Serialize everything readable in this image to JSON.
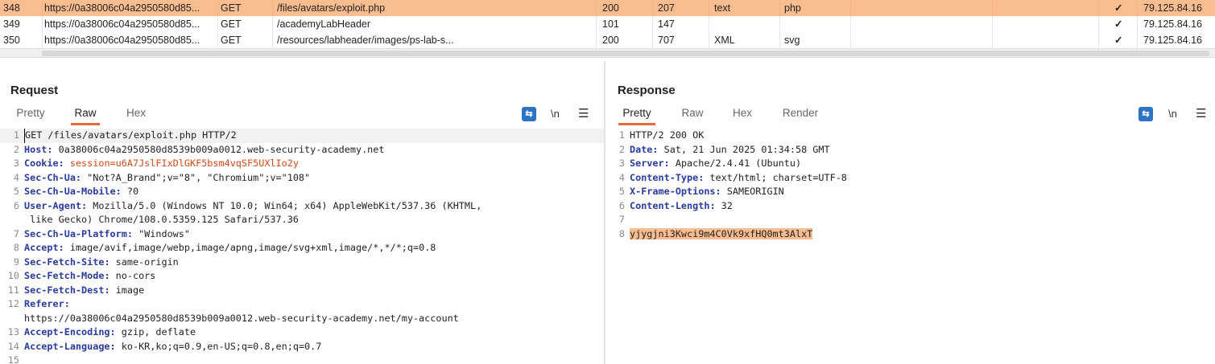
{
  "history": {
    "rows": [
      {
        "num": "348",
        "host": "https://0a38006c04a2950580d85...",
        "method": "GET",
        "url": "/files/avatars/exploit.php",
        "status": "200",
        "length": "207",
        "mime": "text",
        "ext": "php",
        "tls": "✓",
        "ip": "79.125.84.16",
        "selected": true
      },
      {
        "num": "349",
        "host": "https://0a38006c04a2950580d85...",
        "method": "GET",
        "url": "/academyLabHeader",
        "status": "101",
        "length": "147",
        "mime": "",
        "ext": "",
        "tls": "✓",
        "ip": "79.125.84.16",
        "selected": false
      },
      {
        "num": "350",
        "host": "https://0a38006c04a2950580d85...",
        "method": "GET",
        "url": "/resources/labheader/images/ps-lab-s...",
        "status": "200",
        "length": "707",
        "mime": "XML",
        "ext": "svg",
        "tls": "✓",
        "ip": "79.125.84.16",
        "selected": false
      }
    ]
  },
  "request": {
    "title": "Request",
    "tabs": [
      "Pretty",
      "Raw",
      "Hex"
    ],
    "active_tab": "Raw",
    "tools": {
      "wrap_icon": "wrap-lines-icon",
      "newline_label": "\\n",
      "menu_icon": "hamburger-menu-icon"
    },
    "lines": [
      {
        "n": "1",
        "name": "",
        "sep": "",
        "value": "GET /files/avatars/exploit.php HTTP/2"
      },
      {
        "n": "2",
        "name": "Host",
        "sep": ": ",
        "value": "0a38006c04a2950580d8539b009a0012.web-security-academy.net"
      },
      {
        "n": "3",
        "name": "Cookie",
        "sep": ": ",
        "value": "session=u6A7JslFIxDlGKF5bsm4vqSF5UXlIo2y",
        "cookie": true
      },
      {
        "n": "4",
        "name": "Sec-Ch-Ua",
        "sep": ": ",
        "value": "\"Not?A_Brand\";v=\"8\", \"Chromium\";v=\"108\""
      },
      {
        "n": "5",
        "name": "Sec-Ch-Ua-Mobile",
        "sep": ": ",
        "value": "?0"
      },
      {
        "n": "6",
        "name": "User-Agent",
        "sep": ": ",
        "value": "Mozilla/5.0 (Windows NT 10.0; Win64; x64) AppleWebKit/537.36 (KHTML,"
      },
      {
        "n": "",
        "name": "",
        "sep": "",
        "value": " like Gecko) Chrome/108.0.5359.125 Safari/537.36"
      },
      {
        "n": "7",
        "name": "Sec-Ch-Ua-Platform",
        "sep": ": ",
        "value": "\"Windows\""
      },
      {
        "n": "8",
        "name": "Accept",
        "sep": ": ",
        "value": "image/avif,image/webp,image/apng,image/svg+xml,image/*,*/*;q=0.8"
      },
      {
        "n": "9",
        "name": "Sec-Fetch-Site",
        "sep": ": ",
        "value": "same-origin"
      },
      {
        "n": "10",
        "name": "Sec-Fetch-Mode",
        "sep": ": ",
        "value": "no-cors"
      },
      {
        "n": "11",
        "name": "Sec-Fetch-Dest",
        "sep": ": ",
        "value": "image"
      },
      {
        "n": "12",
        "name": "Referer",
        "sep": ":",
        "value": ""
      },
      {
        "n": "",
        "name": "",
        "sep": "",
        "value": "https://0a38006c04a2950580d8539b009a0012.web-security-academy.net/my-account"
      },
      {
        "n": "13",
        "name": "Accept-Encoding",
        "sep": ": ",
        "value": "gzip, deflate"
      },
      {
        "n": "14",
        "name": "Accept-Language",
        "sep": ": ",
        "value": "ko-KR,ko;q=0.9,en-US;q=0.8,en;q=0.7"
      },
      {
        "n": "15",
        "name": "",
        "sep": "",
        "value": ""
      }
    ]
  },
  "response": {
    "title": "Response",
    "tabs": [
      "Pretty",
      "Raw",
      "Hex",
      "Render"
    ],
    "active_tab": "Pretty",
    "tools": {
      "wrap_icon": "wrap-lines-icon",
      "newline_label": "\\n",
      "menu_icon": "hamburger-menu-icon"
    },
    "lines": [
      {
        "n": "1",
        "name": "",
        "sep": "",
        "value": "HTTP/2 200 OK"
      },
      {
        "n": "2",
        "name": "Date",
        "sep": ": ",
        "value": "Sat, 21 Jun 2025 01:34:58 GMT"
      },
      {
        "n": "3",
        "name": "Server",
        "sep": ": ",
        "value": "Apache/2.4.41 (Ubuntu)"
      },
      {
        "n": "4",
        "name": "Content-Type",
        "sep": ": ",
        "value": "text/html; charset=UTF-8"
      },
      {
        "n": "5",
        "name": "X-Frame-Options",
        "sep": ": ",
        "value": "SAMEORIGIN"
      },
      {
        "n": "6",
        "name": "Content-Length",
        "sep": ": ",
        "value": "32"
      },
      {
        "n": "7",
        "name": "",
        "sep": "",
        "value": ""
      },
      {
        "n": "8",
        "name": "",
        "sep": "",
        "value": "yjygjni3Kwci9m4C0Vk9xfHQ0mt3AlxT",
        "highlight": true
      }
    ]
  },
  "layout_buttons": [
    "split-horizontal-icon",
    "split-vertical-icon",
    "single-pane-icon"
  ],
  "colors": {
    "selected_row": "#f9bd8f",
    "accent": "#e8683d",
    "button_blue": "#2f73c7",
    "header_name": "#2a3a9e",
    "cookie_value": "#d24a17"
  }
}
